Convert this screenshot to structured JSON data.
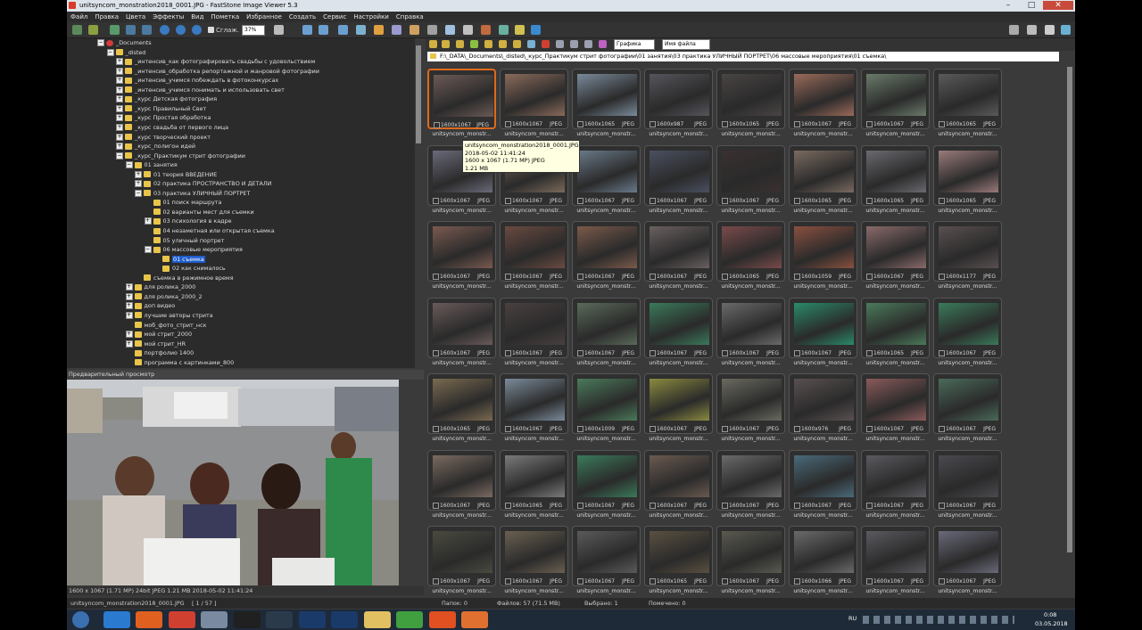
{
  "window": {
    "title": "unitsyncom_monstration2018_0001.JPG  -  FastStone Image Viewer 5.3",
    "controls": [
      "–",
      "□",
      "✕"
    ]
  },
  "menu": [
    "Файл",
    "Правка",
    "Цвета",
    "Эффекты",
    "Вид",
    "Пометка",
    "Избранное",
    "Создать",
    "Сервис",
    "Настройки",
    "Справка"
  ],
  "toolbar": {
    "smooth_label": "Сглаж.",
    "zoom_value": "37%"
  },
  "tree": [
    {
      "label": "_Documents",
      "indent": 4,
      "exp": "−",
      "red": true
    },
    {
      "label": "_disted",
      "indent": 5,
      "exp": "−"
    },
    {
      "label": "_интенсив_как фотографировать свадьбы с удовольствием",
      "indent": 6,
      "exp": "+"
    },
    {
      "label": "_интенсив_обработка репортажной и жанровой фотографии",
      "indent": 6,
      "exp": "+"
    },
    {
      "label": "_интенсив_учимся побеждать в фотоконкурсах",
      "indent": 6,
      "exp": "+"
    },
    {
      "label": "_интенсив_учимся понимать и использовать свет",
      "indent": 6,
      "exp": "+"
    },
    {
      "label": "_курс Детская фотография",
      "indent": 6,
      "exp": "+"
    },
    {
      "label": "_курс Правильный Свет",
      "indent": 6,
      "exp": "+"
    },
    {
      "label": "_курс Простая обработка",
      "indent": 6,
      "exp": "+"
    },
    {
      "label": "_курс свадьба от первого лица",
      "indent": 6,
      "exp": "+"
    },
    {
      "label": "_курс творческий проект",
      "indent": 6,
      "exp": "+"
    },
    {
      "label": "_курс_полигон идей",
      "indent": 6,
      "exp": "+"
    },
    {
      "label": "_курс_Практикум стрит фотографии",
      "indent": 6,
      "exp": "−"
    },
    {
      "label": "01 занятия",
      "indent": 7,
      "exp": "−"
    },
    {
      "label": "01 теория ВВЕДЕНИЕ",
      "indent": 8,
      "exp": "+"
    },
    {
      "label": "02 практика ПРОСТРАНСТВО И ДЕТАЛИ",
      "indent": 8,
      "exp": "+"
    },
    {
      "label": "03 практика УЛИЧНЫЙ ПОРТРЕТ",
      "indent": 8,
      "exp": "−"
    },
    {
      "label": "01 поиск маршрута",
      "indent": 9,
      "exp": ""
    },
    {
      "label": "02 варианты мест для съемки",
      "indent": 9,
      "exp": ""
    },
    {
      "label": "03 психология в кадре",
      "indent": 9,
      "exp": "+"
    },
    {
      "label": "04 незаметная или открытая съемка",
      "indent": 9,
      "exp": ""
    },
    {
      "label": "05 уличный портрет",
      "indent": 9,
      "exp": ""
    },
    {
      "label": "06 массовые мероприятия",
      "indent": 9,
      "exp": "−"
    },
    {
      "label": "01 съемка",
      "indent": 10,
      "exp": "",
      "selected": true
    },
    {
      "label": "02 как снималось",
      "indent": 10,
      "exp": ""
    },
    {
      "label": "съемка в режимное время",
      "indent": 8,
      "exp": ""
    },
    {
      "label": "для ролика_2000",
      "indent": 7,
      "exp": "+"
    },
    {
      "label": "для ролика_2000_2",
      "indent": 7,
      "exp": "+"
    },
    {
      "label": "доп видео",
      "indent": 7,
      "exp": "+"
    },
    {
      "label": "лучшие авторы стрита",
      "indent": 7,
      "exp": "+"
    },
    {
      "label": "моб_фото_стрит_нск",
      "indent": 7,
      "exp": ""
    },
    {
      "label": "мой стрит_2000",
      "indent": 7,
      "exp": "+"
    },
    {
      "label": "мой стрит_HR",
      "indent": 7,
      "exp": "+"
    },
    {
      "label": "портфолио 1400",
      "indent": 7,
      "exp": ""
    },
    {
      "label": "программа с картинками_800",
      "indent": 7,
      "exp": ""
    }
  ],
  "preview": {
    "header": "Предварительный просмотр",
    "status": "1600 x 1067 (1.71 MP)  24bit  JPEG  1.21 MB   2018-05-02 11:41:24"
  },
  "browser": {
    "filter_combo": "Графика",
    "sort_combo": "Имя файла",
    "path": "F:\\_DATA\\_Documents\\_disted\\_курс_Практикум стрит фотографии\\01 занятия\\03 практика УЛИЧНЫЙ ПОРТРЕТ\\06 массовые мероприятия\\01 съемка\\"
  },
  "tooltip": {
    "line1": "unitsyncom_monstration2018_0001.JPG",
    "line2": "2018-05-02 11:41:24",
    "line3": "1600 x 1067 (1.71 MP)  JPEG",
    "line4": "1.21 MB"
  },
  "thumb_name": "unitsyncom_monstr...",
  "thumbs": [
    {
      "dims": "1600x1067",
      "type": "JPEG",
      "color": "#6b5a55"
    },
    {
      "dims": "1600x1067",
      "type": "JPEG",
      "color": "#8a6a5a"
    },
    {
      "dims": "1600x1065",
      "type": "JPEG",
      "color": "#7a8a9a"
    },
    {
      "dims": "1600x987",
      "type": "JPEG",
      "color": "#55555c"
    },
    {
      "dims": "1600x1065",
      "type": "JPEG",
      "color": "#4a4444"
    },
    {
      "dims": "1600x1067",
      "type": "JPEG",
      "color": "#9a6a5a"
    },
    {
      "dims": "1600x1067",
      "type": "JPEG",
      "color": "#6a7a6a"
    },
    {
      "dims": "1600x1065",
      "type": "JPEG",
      "color": "#5a5a5a"
    },
    {
      "dims": "1600x1067",
      "type": "JPEG",
      "color": "#6a6a7a"
    },
    {
      "dims": "1600x1067",
      "type": "JPEG",
      "color": "#7a6a5a"
    },
    {
      "dims": "1600x1067",
      "type": "JPEG",
      "color": "#6a7a8a"
    },
    {
      "dims": "1600x1067",
      "type": "JPEG",
      "color": "#4a5060"
    },
    {
      "dims": "1600x1067",
      "type": "JPEG",
      "color": "#3a3030"
    },
    {
      "dims": "1600x1065",
      "type": "JPEG",
      "color": "#7a6a60"
    },
    {
      "dims": "1600x1065",
      "type": "JPEG",
      "color": "#6a6a70"
    },
    {
      "dims": "1600x1065",
      "type": "JPEG",
      "color": "#9a7a7a"
    },
    {
      "dims": "1600x1067",
      "type": "JPEG",
      "color": "#7a5a50"
    },
    {
      "dims": "1600x1067",
      "type": "JPEG",
      "color": "#6a4a40"
    },
    {
      "dims": "1600x1067",
      "type": "JPEG",
      "color": "#7a5a4a"
    },
    {
      "dims": "1600x1067",
      "type": "JPEG",
      "color": "#6a6060"
    },
    {
      "dims": "1600x1065",
      "type": "JPEG",
      "color": "#7a4a4a"
    },
    {
      "dims": "1600x1059",
      "type": "JPEG",
      "color": "#8a5040"
    },
    {
      "dims": "1600x1067",
      "type": "JPEG",
      "color": "#8a6a6a"
    },
    {
      "dims": "1600x1177",
      "type": "JPEG",
      "color": "#5a5050"
    },
    {
      "dims": "1600x1067",
      "type": "JPEG",
      "color": "#6a5a5a"
    },
    {
      "dims": "1600x1067",
      "type": "JPEG",
      "color": "#4a4040"
    },
    {
      "dims": "1600x1067",
      "type": "JPEG",
      "color": "#5a6a5a"
    },
    {
      "dims": "1600x1067",
      "type": "JPEG",
      "color": "#3a7a5a"
    },
    {
      "dims": "1600x1067",
      "type": "JPEG",
      "color": "#6a6a6a"
    },
    {
      "dims": "1600x1067",
      "type": "JPEG",
      "color": "#2a8a6a"
    },
    {
      "dims": "1600x1065",
      "type": "JPEG",
      "color": "#4a7a5a"
    },
    {
      "dims": "1600x1067",
      "type": "JPEG",
      "color": "#3a7a5a"
    },
    {
      "dims": "1600x1065",
      "type": "JPEG",
      "color": "#7a6a50"
    },
    {
      "dims": "1600x1067",
      "type": "JPEG",
      "color": "#7a8a9a"
    },
    {
      "dims": "1600x1009",
      "type": "JPEG",
      "color": "#4a7a5a"
    },
    {
      "dims": "1600x1067",
      "type": "JPEG",
      "color": "#8a8a40"
    },
    {
      "dims": "1600x1067",
      "type": "JPEG",
      "color": "#6a6a60"
    },
    {
      "dims": "1600x976",
      "type": "JPEG",
      "color": "#5a5050"
    },
    {
      "dims": "1600x1067",
      "type": "JPEG",
      "color": "#8a5a5a"
    },
    {
      "dims": "1600x1067",
      "type": "JPEG",
      "color": "#4a6a5a"
    },
    {
      "dims": "1600x1067",
      "type": "JPEG",
      "color": "#7a6a60"
    },
    {
      "dims": "1600x1065",
      "type": "JPEG",
      "color": "#7a7a7a"
    },
    {
      "dims": "1600x1067",
      "type": "JPEG",
      "color": "#3a7a5a"
    },
    {
      "dims": "1600x1067",
      "type": "JPEG",
      "color": "#6a5a50"
    },
    {
      "dims": "1600x1067",
      "type": "JPEG",
      "color": "#6a6a6a"
    },
    {
      "dims": "1600x1067",
      "type": "JPEG",
      "color": "#4a6a7a"
    },
    {
      "dims": "1600x1067",
      "type": "JPEG",
      "color": "#5a5a60"
    },
    {
      "dims": "1600x1067",
      "type": "JPEG",
      "color": "#4a4a50"
    },
    {
      "dims": "1600x1067",
      "type": "JPEG",
      "color": "#4a4a40"
    },
    {
      "dims": "1600x1067",
      "type": "JPEG",
      "color": "#6a6050"
    },
    {
      "dims": "1600x1067",
      "type": "JPEG",
      "color": "#5a5a5a"
    },
    {
      "dims": "1600x1065",
      "type": "JPEG",
      "color": "#5a5040"
    },
    {
      "dims": "1600x1067",
      "type": "JPEG",
      "color": "#5a5a50"
    },
    {
      "dims": "1600x1066",
      "type": "JPEG",
      "color": "#6a6a6a"
    },
    {
      "dims": "1600x1067",
      "type": "JPEG",
      "color": "#5a5a60"
    },
    {
      "dims": "1600x1067",
      "type": "JPEG",
      "color": "#6a6a7a"
    }
  ],
  "status": {
    "file": "unitsyncom_monstration2018_0001.JPG",
    "index": "[ 1 / 57 ]",
    "folders": "Папок: 0",
    "files": "Файлов: 57 (71.5 MB)",
    "selected": "Выбрано: 1",
    "marked": "Помечено: 0"
  },
  "taskbar": {
    "lang": "RU",
    "time": "0:08",
    "date": "03.05.2018",
    "apps": [
      {
        "name": "start",
        "color": "#3a6fb0"
      },
      {
        "name": "ie",
        "color": "#2a7ad0"
      },
      {
        "name": "firefox",
        "color": "#e06020"
      },
      {
        "name": "chrome",
        "color": "#d04030"
      },
      {
        "name": "app1",
        "color": "#7a8aa0"
      },
      {
        "name": "nx",
        "color": "#202020"
      },
      {
        "name": "lr",
        "color": "#2a3a4a"
      },
      {
        "name": "ps",
        "color": "#1a3a6a"
      },
      {
        "name": "ps2",
        "color": "#1a3a6a"
      },
      {
        "name": "explorer",
        "color": "#e0c060"
      },
      {
        "name": "app2",
        "color": "#40a040"
      },
      {
        "name": "app3",
        "color": "#e05020"
      },
      {
        "name": "faststone",
        "color": "#e07030"
      }
    ]
  },
  "colors": {
    "accent": "#1f5ccc",
    "selection": "#e06a1b",
    "folder": "#e8c54a"
  }
}
